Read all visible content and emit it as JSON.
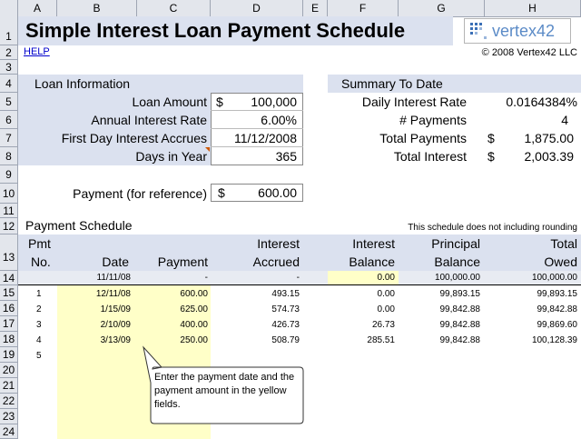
{
  "columns": [
    "A",
    "B",
    "C",
    "D",
    "E",
    "F",
    "G",
    "H"
  ],
  "rows": [
    "1",
    "2",
    "3",
    "4",
    "5",
    "6",
    "7",
    "8",
    "9",
    "10",
    "11",
    "12",
    "13",
    "14",
    "15",
    "16",
    "17",
    "18",
    "19",
    "20",
    "21",
    "22",
    "23",
    "24"
  ],
  "title": "Simple Interest Loan Payment Schedule",
  "logo_text": "vertex42",
  "help_link": "HELP",
  "copyright": "© 2008 Vertex42 LLC",
  "loan_info": {
    "header": "Loan Information",
    "amount_label": "Loan Amount",
    "amount_currency": "$",
    "amount_value": "100,000",
    "rate_label": "Annual Interest Rate",
    "rate_value": "6.00%",
    "first_day_label": "First Day Interest Accrues",
    "first_day_value": "11/12/2008",
    "days_label": "Days in Year",
    "days_value": "365"
  },
  "payment_ref": {
    "label": "Payment (for reference)",
    "currency": "$",
    "value": "600.00"
  },
  "summary": {
    "header": "Summary To Date",
    "daily_label": "Daily Interest Rate",
    "daily_value": "0.0164384%",
    "num_label": "# Payments",
    "num_value": "4",
    "total_pay_label": "Total Payments",
    "total_pay_currency": "$",
    "total_pay_value": "1,875.00",
    "total_int_label": "Total Interest",
    "total_int_currency": "$",
    "total_int_value": "2,003.39"
  },
  "schedule": {
    "title": "Payment Schedule",
    "note": "This schedule does not including rounding",
    "headers": {
      "pmt1": "Pmt",
      "pmt2": "No.",
      "date": "Date",
      "payment": "Payment",
      "accrued1": "Interest",
      "accrued2": "Accrued",
      "balance1": "Interest",
      "balance2": "Balance",
      "principal1": "Principal",
      "principal2": "Balance",
      "owed1": "Total",
      "owed2": "Owed"
    },
    "initial": {
      "date": "11/11/08",
      "payment": "-",
      "accrued": "-",
      "int_balance": "0.00",
      "principal": "100,000.00",
      "owed": "100,000.00"
    },
    "rows": [
      {
        "no": "1",
        "date": "12/11/08",
        "payment": "600.00",
        "accrued": "493.15",
        "int_balance": "0.00",
        "principal": "99,893.15",
        "owed": "99,893.15"
      },
      {
        "no": "2",
        "date": "1/15/09",
        "payment": "625.00",
        "accrued": "574.73",
        "int_balance": "0.00",
        "principal": "99,842.88",
        "owed": "99,842.88"
      },
      {
        "no": "3",
        "date": "2/10/09",
        "payment": "400.00",
        "accrued": "426.73",
        "int_balance": "26.73",
        "principal": "99,842.88",
        "owed": "99,869.60"
      },
      {
        "no": "4",
        "date": "3/13/09",
        "payment": "250.00",
        "accrued": "508.79",
        "int_balance": "285.51",
        "principal": "99,842.88",
        "owed": "100,128.39"
      }
    ],
    "next_no": "5"
  },
  "callout": "Enter the payment date and the payment amount in the yellow fields."
}
